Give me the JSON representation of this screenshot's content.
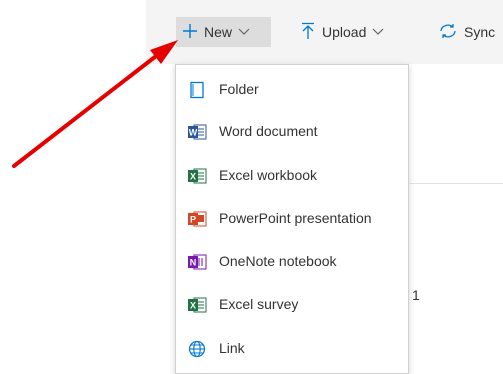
{
  "commandbar": {
    "new_label": "New",
    "upload_label": "Upload",
    "sync_label": "Sync"
  },
  "content": {
    "partial_text": "1"
  },
  "menu": {
    "items": [
      {
        "label": "Folder",
        "icon": "folder-icon"
      },
      {
        "label": "Word document",
        "icon": "word-icon"
      },
      {
        "label": "Excel workbook",
        "icon": "excel-icon"
      },
      {
        "label": "PowerPoint presentation",
        "icon": "powerpoint-icon"
      },
      {
        "label": "OneNote notebook",
        "icon": "onenote-icon"
      },
      {
        "label": "Excel survey",
        "icon": "excel-icon"
      },
      {
        "label": "Link",
        "icon": "globe-icon"
      }
    ]
  },
  "colors": {
    "word": "#2b579a",
    "excel": "#217346",
    "powerpoint": "#d24726",
    "onenote": "#7719aa",
    "link": "#0078d4",
    "annotation_arrow": "#e60000"
  }
}
